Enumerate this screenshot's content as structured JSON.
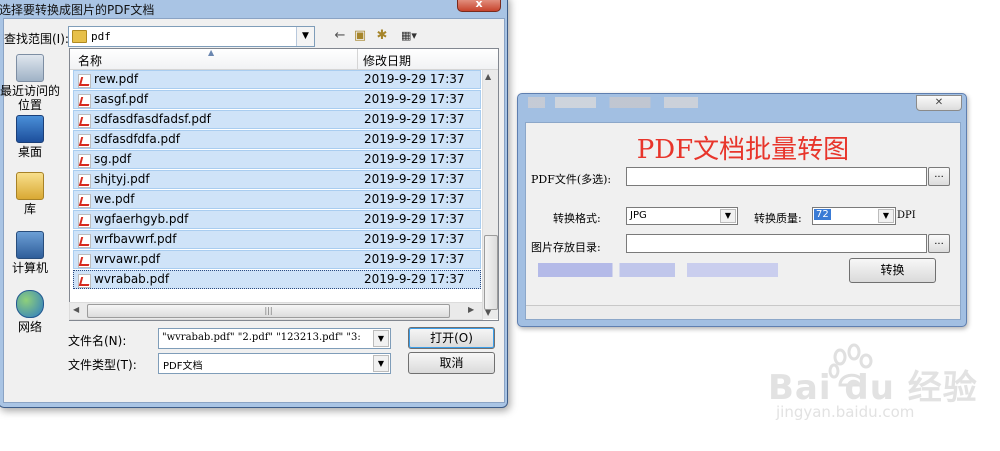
{
  "dialog": {
    "title": "选择要转换成图片的PDF文档",
    "close_label": "x",
    "look_in_label": "查找范围(I):",
    "look_in_value": "pdf",
    "places": [
      {
        "label": "最近访问的位置",
        "icon": "recent-places-icon"
      },
      {
        "label": "桌面",
        "icon": "desktop-icon"
      },
      {
        "label": "库",
        "icon": "libraries-icon"
      },
      {
        "label": "计算机",
        "icon": "computer-icon"
      },
      {
        "label": "网络",
        "icon": "network-icon"
      }
    ],
    "columns": {
      "name": "名称",
      "date": "修改日期"
    },
    "files": [
      {
        "name": "rew.pdf",
        "date": "2019-9-29 17:37"
      },
      {
        "name": "sasgf.pdf",
        "date": "2019-9-29 17:37"
      },
      {
        "name": "sdfasdfasdfadsf.pdf",
        "date": "2019-9-29 17:37"
      },
      {
        "name": "sdfasdfdfa.pdf",
        "date": "2019-9-29 17:37"
      },
      {
        "name": "sg.pdf",
        "date": "2019-9-29 17:37"
      },
      {
        "name": "shjtyj.pdf",
        "date": "2019-9-29 17:37"
      },
      {
        "name": "we.pdf",
        "date": "2019-9-29 17:37"
      },
      {
        "name": "wgfaerhgyb.pdf",
        "date": "2019-9-29 17:37"
      },
      {
        "name": "wrfbavwrf.pdf",
        "date": "2019-9-29 17:37"
      },
      {
        "name": "wrvawr.pdf",
        "date": "2019-9-29 17:37"
      },
      {
        "name": "wvrabab.pdf",
        "date": "2019-9-29 17:37"
      }
    ],
    "file_name_label": "文件名(N):",
    "file_name_value": "\"wvrabab.pdf\" \"2.pdf\" \"123213.pdf\" \"3:",
    "file_type_label": "文件类型(T):",
    "file_type_value": "PDF文档",
    "open_label": "打开(O)",
    "cancel_label": "取消",
    "hscroll_grip": "|||"
  },
  "app": {
    "heading": "PDF文档批量转图",
    "pdf_files_label": "PDF文件(多选):",
    "browse_label": "...",
    "format_label": "转换格式:",
    "format_value": "JPG",
    "quality_label": "转换质量:",
    "quality_value": "72",
    "dpi_label": "DPI",
    "output_dir_label": "图片存放目录:",
    "convert_label": "转换"
  },
  "watermark": {
    "brand": "Bai du 经验",
    "url": "jingyan.baidu.com"
  },
  "colors": {
    "accent_red": "#e8352b",
    "selection": "#cfe3f8",
    "frame": "#a9c4e4"
  }
}
